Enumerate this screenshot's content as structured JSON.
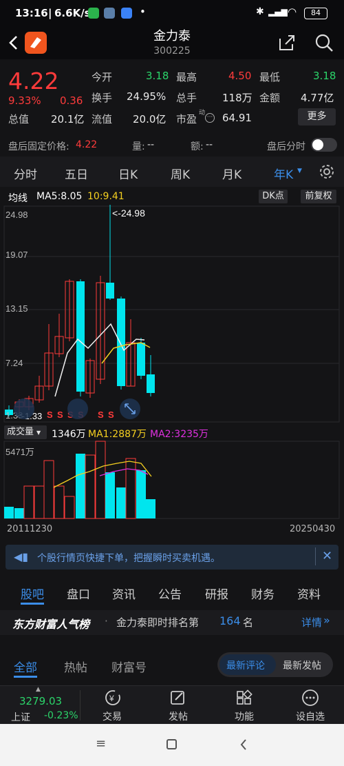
{
  "status_bar": {
    "time": "13:16",
    "speed": "6.6K/s",
    "battery": "84"
  },
  "header": {
    "name": "金力泰",
    "code": "300225"
  },
  "quote": {
    "price": "4.22",
    "change_pct": "9.33%",
    "change": "0.36",
    "open_label": "今开",
    "open": "3.18",
    "high_label": "最高",
    "high": "4.50",
    "low_label": "最低",
    "low": "3.18",
    "turnover_label": "换手",
    "turnover": "24.95%",
    "volume_label": "总手",
    "volume": "118万",
    "amount_label": "金额",
    "amount": "4.77亿",
    "mcap_label": "总值",
    "mcap": "20.1亿",
    "float_label": "流值",
    "float": "20.0亿",
    "pe_label": "市盈",
    "pe_sup": "动",
    "pe": "64.91",
    "more_label": "更多"
  },
  "after_hours": {
    "price_label": "盘后固定价格:",
    "price": "4.22",
    "vol_label": "量:",
    "vol": "--",
    "amt_label": "额:",
    "amt": "--",
    "tick_label": "盘后分时"
  },
  "tabs": [
    "分时",
    "五日",
    "日K",
    "周K",
    "月K",
    "年K"
  ],
  "chart": {
    "ma_label": "均线",
    "ma5": "MA5:8.05",
    "ma10": "10:9.41",
    "dk_label": "DK点",
    "adj_label": "前复权",
    "y_ticks": [
      "24.98",
      "19.07",
      "13.15",
      "7.24",
      "1.33"
    ],
    "max_marker": "<-24.98",
    "min_marker": "<-1.33",
    "vol_label": "成交量",
    "vol_value": "1346万",
    "vma1": "MA1:2887万",
    "vma2": "MA2:3235万",
    "vol_max": "5471万",
    "date_start": "20111230",
    "date_end": "20250430",
    "s_marks": [
      "S",
      "S",
      "S",
      "S",
      "S",
      "S"
    ]
  },
  "banner": {
    "text": "个股行情页快捷下单，把握瞬时买卖机遇。"
  },
  "sub_tabs": [
    "股吧",
    "盘口",
    "资讯",
    "公告",
    "研报",
    "财务",
    "资料"
  ],
  "rank": {
    "brand": "东方财富人气榜",
    "text": "金力泰即时排名第",
    "num": "164",
    "unit": "名",
    "detail": "详情"
  },
  "feed_tabs": [
    "全部",
    "热帖",
    "财富号"
  ],
  "seg": [
    "最新评论",
    "最新发帖"
  ],
  "bottom": {
    "index_value": "3279.03",
    "index_name": "上证",
    "index_change": "-0.23%",
    "items": [
      "交易",
      "发帖",
      "功能",
      "设自选"
    ]
  },
  "colors": {
    "up": "#ff3b3b",
    "down": "#00e5ee",
    "accent": "#3b8de8"
  }
}
